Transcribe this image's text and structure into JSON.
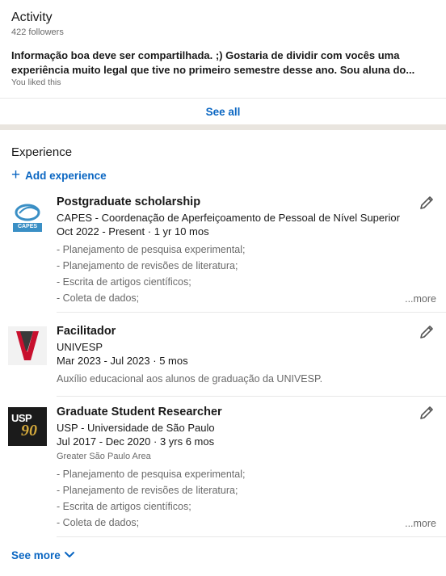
{
  "activity": {
    "title": "Activity",
    "followers": "422 followers",
    "post_line1": "Informação boa deve ser compartilhada. ;) Gostaria de dividir com vocês uma",
    "post_line2": "experiência muito legal que tive no primeiro semestre desse ano. Sou aluna do...",
    "liked": "You liked this",
    "see_all": "See all"
  },
  "experience": {
    "title": "Experience",
    "add_label": "Add experience",
    "see_more": "See more",
    "entries": [
      {
        "role": "Postgraduate scholarship",
        "org": "CAPES - Coordenação de Aperfeiçoamento de Pessoal de Nível Superior",
        "dates": "Oct 2022 - Present",
        "duration": "1 yr 10 mos",
        "logo_text": "CAPES",
        "desc": [
          "- Planejamento de pesquisa experimental;",
          "- Planejamento de revisões de literatura;",
          "- Escrita de artigos científicos;",
          "- Coleta de dados;"
        ],
        "more": "...more"
      },
      {
        "role": "Facilitador",
        "org": "UNIVESP",
        "dates": "Mar 2023 - Jul 2023",
        "duration": "5 mos",
        "desc": [
          "Auxílio educacional aos alunos de graduação da UNIVESP."
        ]
      },
      {
        "role": "Graduate Student Researcher",
        "org": "USP - Universidade de São Paulo",
        "dates": "Jul 2017 - Dec 2020",
        "duration": "3 yrs 6 mos",
        "location": "Greater São Paulo Area",
        "logo_text": "USP",
        "logo_number": "90",
        "desc": [
          "- Planejamento de pesquisa experimental;",
          "- Planejamento de revisões de literatura;",
          "- Escrita de artigos científicos;",
          "- Coleta de dados;"
        ],
        "more": "...more"
      }
    ]
  },
  "colors": {
    "link": "#0a66c2",
    "section_gap": "#e9e5df",
    "capes_blue": "#3a8fc5",
    "univesp_red": "#c8102e",
    "usp_bg": "#1b1b1b",
    "usp_gold": "#d4a93c"
  }
}
